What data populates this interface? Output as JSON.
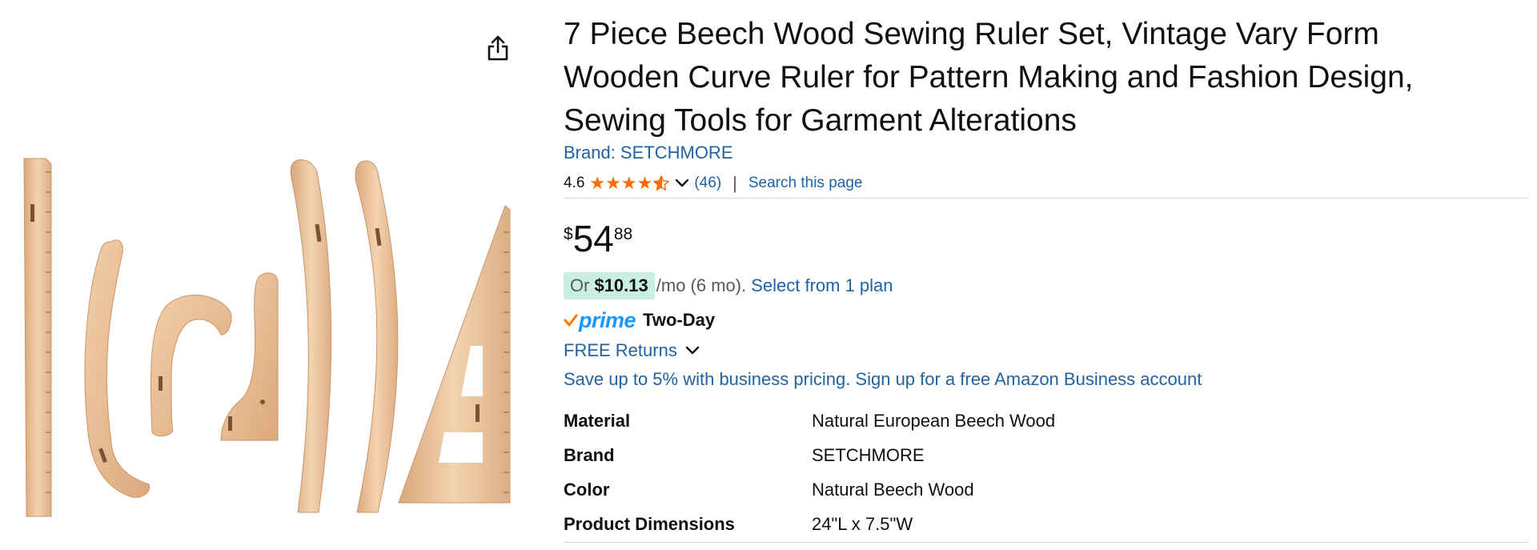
{
  "product": {
    "title": "7 Piece Beech Wood Sewing Ruler Set, Vintage Vary Form Wooden Curve Ruler for Pattern Making and Fashion Design, Sewing Tools for Garment Alterations",
    "brand_link": "Brand: SETCHMORE",
    "image_alt": "Seven beech wood sewing rulers"
  },
  "rating": {
    "value": "4.6",
    "stars": 4.6,
    "count": "(46)",
    "separator": "|",
    "search_link": "Search this page"
  },
  "price": {
    "symbol": "$",
    "whole": "54",
    "fraction": "88"
  },
  "installment": {
    "or": "Or",
    "amount": "$10.13",
    "term": "/mo (6 mo).",
    "link": "Select from 1 plan"
  },
  "delivery": {
    "prime": "prime",
    "speed": "Two-Day"
  },
  "returns": {
    "label": "FREE Returns"
  },
  "business": {
    "link": "Save up to 5% with business pricing. Sign up for a free Amazon Business account"
  },
  "specs": [
    {
      "label": "Material",
      "value": "Natural European Beech Wood"
    },
    {
      "label": "Brand",
      "value": "SETCHMORE"
    },
    {
      "label": "Color",
      "value": "Natural Beech Wood"
    },
    {
      "label": "Product Dimensions",
      "value": "24\"L x 7.5\"W"
    }
  ],
  "icons": {
    "share": "share-icon",
    "star": "star-icon",
    "chevron": "chevron-down-icon",
    "prime_check": "prime-check-icon"
  },
  "colors": {
    "link": "#2162a1",
    "star": "#ff6a00",
    "prime": "#1a98ff",
    "installment_badge": "#c9efe4",
    "wood": "#eac49c"
  }
}
